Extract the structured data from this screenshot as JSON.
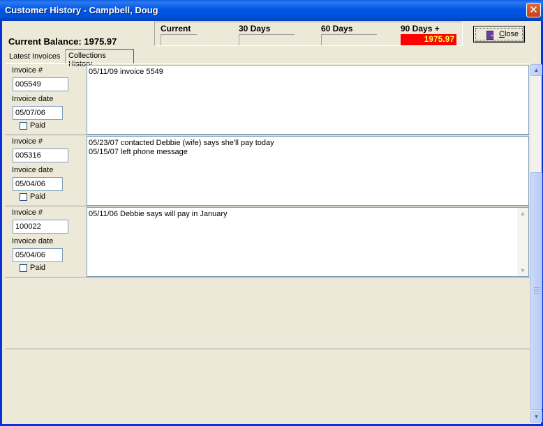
{
  "window": {
    "title": "Customer History - Campbell, Doug",
    "close_glyph": "✕"
  },
  "header": {
    "balance_label": "Current Balance:",
    "balance_value": "1975.97",
    "aging": {
      "current_label": "Current",
      "days30_label": "30 Days",
      "days60_label": "60 Days",
      "days90_label": "90 Days +",
      "days90_value": "1975.97",
      "days90_color": "#ff0000"
    },
    "close_button": {
      "label_first": "C",
      "label_rest": "lose",
      "icon": "door-exit-icon"
    }
  },
  "tabs": [
    {
      "label": "Latest Invoices"
    },
    {
      "label": "Collections History"
    }
  ],
  "labels": {
    "invoice": "Invoice #",
    "invoice_date": "Invoice date",
    "paid": "Paid"
  },
  "rows": [
    {
      "invoice_no": "005549",
      "invoice_date": "05/07/06",
      "notes": [
        "05/11/09 invoice 5549"
      ]
    },
    {
      "invoice_no": "005316",
      "invoice_date": "05/04/06",
      "notes": [
        "05/23/07 contacted Debbie (wife) says she'll pay today",
        "05/15/07 left phone message"
      ]
    },
    {
      "invoice_no": "100022",
      "invoice_date": "05/04/06",
      "notes": [
        "05/11/06 Debbie says will pay in January"
      ]
    }
  ]
}
